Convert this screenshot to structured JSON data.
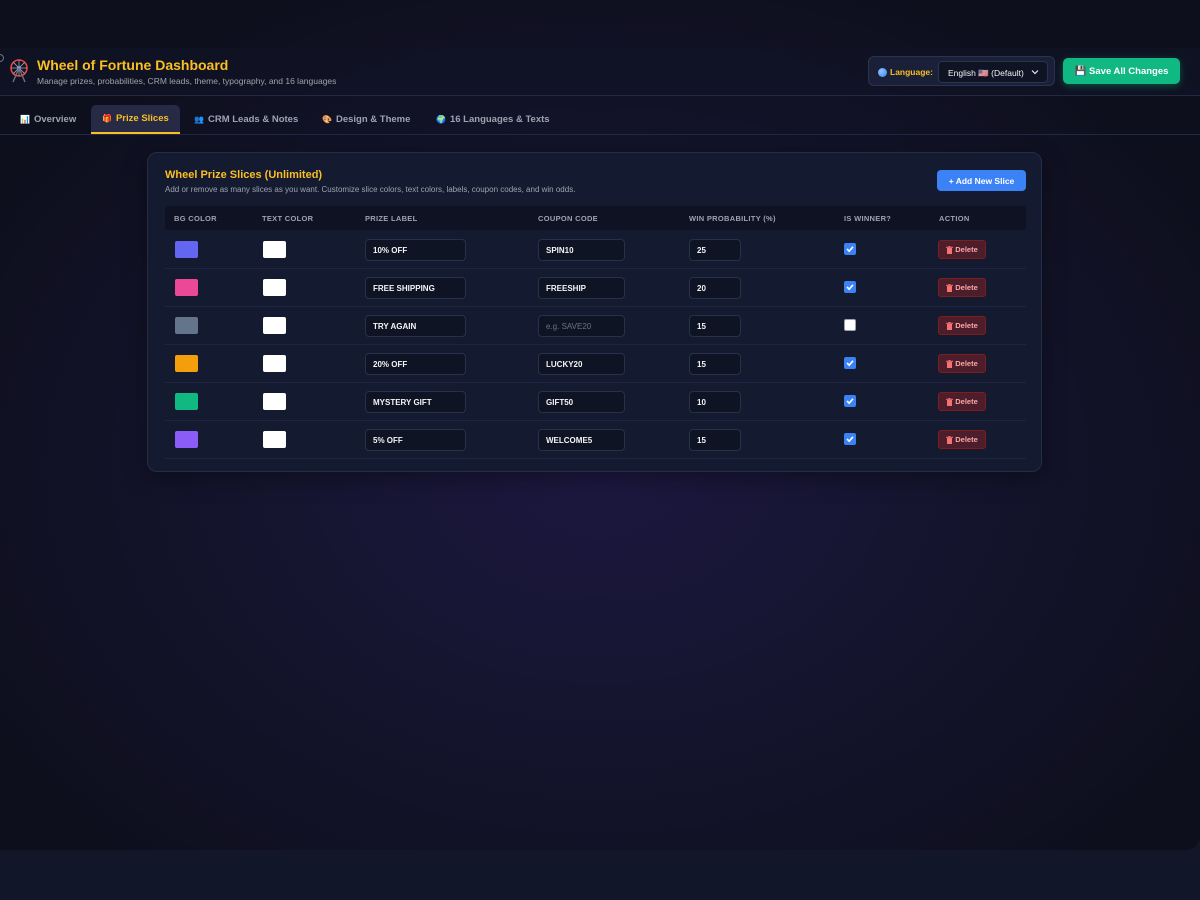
{
  "header": {
    "title": "Wheel of Fortune Dashboard",
    "subtitle": "Manage prizes, probabilities, CRM leads, theme, typography, and 16 languages",
    "language_label": "Language:",
    "language_selected": "English 🇺🇸 (Default)",
    "save_label": "💾 Save All Changes"
  },
  "tabs": [
    {
      "icon": "📊",
      "label": "Overview"
    },
    {
      "icon": "🎁",
      "label": "Prize Slices"
    },
    {
      "icon": "👥",
      "label": "CRM Leads & Notes"
    },
    {
      "icon": "🎨",
      "label": "Design & Theme"
    },
    {
      "icon": "🌍",
      "label": "16 Languages & Texts"
    }
  ],
  "active_tab": "Prize Slices",
  "section": {
    "title": "Wheel Prize Slices (Unlimited)",
    "subtitle": "Add or remove as many slices as you want. Customize slice colors, text colors, labels, coupon codes, and win odds.",
    "add_label": "+ Add New Slice",
    "columns": [
      "BG COLOR",
      "TEXT COLOR",
      "PRIZE LABEL",
      "COUPON CODE",
      "WIN PROBABILITY (%)",
      "IS WINNER?",
      "ACTION"
    ],
    "coupon_placeholder": "e.g. SAVE20",
    "delete_label": "Delete"
  },
  "slices": [
    {
      "bg_color": "#6366f1",
      "text_color": "#ffffff",
      "label": "10% OFF",
      "coupon": "SPIN10",
      "probability": "25",
      "is_winner": true
    },
    {
      "bg_color": "#ec4899",
      "text_color": "#ffffff",
      "label": "FREE SHIPPING",
      "coupon": "FREESHIP",
      "probability": "20",
      "is_winner": true
    },
    {
      "bg_color": "#64748b",
      "text_color": "#ffffff",
      "label": "TRY AGAIN",
      "coupon": "",
      "probability": "15",
      "is_winner": false
    },
    {
      "bg_color": "#f59e0b",
      "text_color": "#ffffff",
      "label": "20% OFF",
      "coupon": "LUCKY20",
      "probability": "15",
      "is_winner": true
    },
    {
      "bg_color": "#10b981",
      "text_color": "#ffffff",
      "label": "MYSTERY GIFT",
      "coupon": "GIFT50",
      "probability": "10",
      "is_winner": true
    },
    {
      "bg_color": "#8b5cf6",
      "text_color": "#ffffff",
      "label": "5% OFF",
      "coupon": "WELCOME5",
      "probability": "15",
      "is_winner": true
    }
  ],
  "colors": {
    "accent": "#fbbf24",
    "primary": "#3b82f6",
    "success": "#10b981",
    "danger": "#7f1d1d"
  }
}
